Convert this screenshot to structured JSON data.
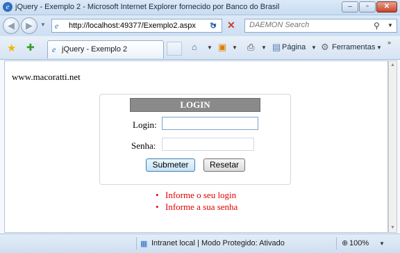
{
  "window": {
    "title": "jQuery - Exemplo 2 - Microsoft Internet Explorer fornecido por Banco do Brasil",
    "min_glyph": "–",
    "max_glyph": "▫",
    "close_glyph": "✕"
  },
  "address_bar": {
    "url": "http://localhost:49377/Exemplo2.aspx"
  },
  "search": {
    "placeholder": "DAEMON Search"
  },
  "tab": {
    "label": "jQuery - Exemplo 2"
  },
  "commands": {
    "page_label": "Página",
    "tools_label": "Ferramentas"
  },
  "page": {
    "site_text": "www.macoratti.net",
    "login_header": "LOGIN",
    "login_label": "Login:",
    "senha_label": "Senha:",
    "login_value": "",
    "senha_value": "",
    "submit_label": "Submeter",
    "reset_label": "Resetar",
    "errors": [
      "Informe o seu login",
      "Informe a sua senha"
    ]
  },
  "status": {
    "zone_text": "Intranet local | Modo Protegido: Ativado",
    "zoom": "100%"
  },
  "colors": {
    "error": "#e00000",
    "header_bg": "#8a8a8a"
  }
}
